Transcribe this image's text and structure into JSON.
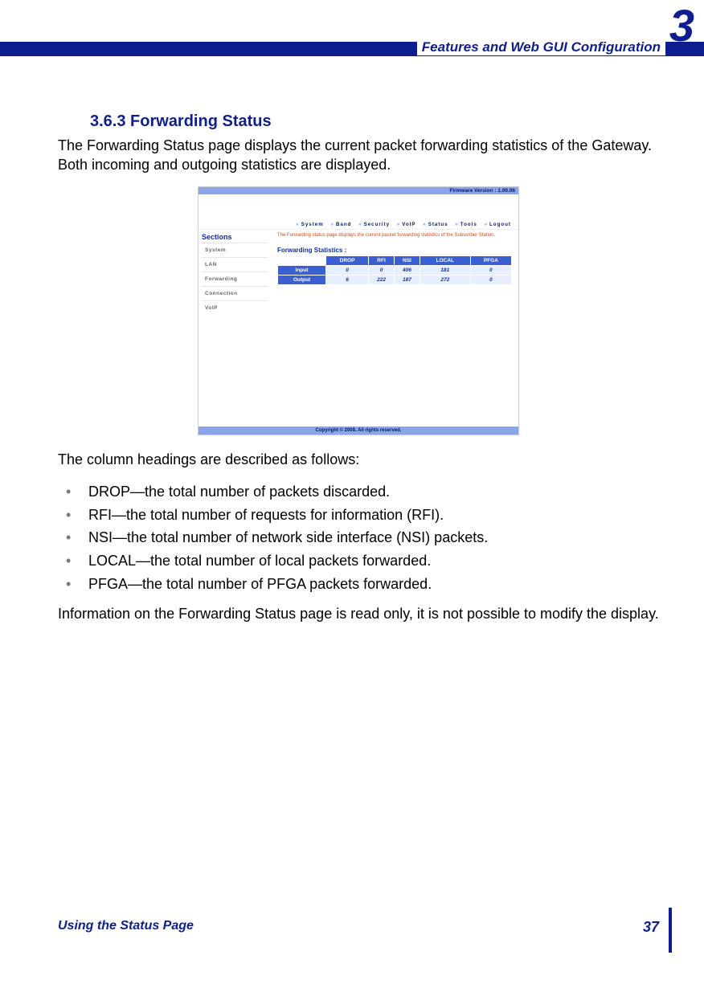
{
  "header": {
    "chapter_title": "Features and Web GUI Configuration",
    "chapter_number": "3"
  },
  "section": {
    "number_title": "3.6.3 Forwarding Status",
    "intro": "The Forwarding Status page displays the current packet forwarding statistics of the Gateway. Both incoming and outgoing statistics are displayed.",
    "post_shot": "The column headings are described as follows:",
    "bullets": [
      "DROP—the total number of packets discarded.",
      "RFI—the total number of requests for information (RFI).",
      "NSI—the total number of network side interface (NSI) packets.",
      "LOCAL—the total number of local packets forwarded.",
      "PFGA—the total number of PFGA packets forwarded."
    ],
    "closing": "Information on the Forwarding Status page is read only, it is not possible to modify the display."
  },
  "screenshot": {
    "firmware": "Firmware Version : 1.00.06",
    "menu": [
      "System",
      "Band",
      "Security",
      "VoIP",
      "Status",
      "Tools",
      "Logout"
    ],
    "sidebar_title": "Sections",
    "sidebar": [
      "System",
      "LAN",
      "Forwarding",
      "Connection",
      "VoIP"
    ],
    "pane_desc": "The Forwarding status page displays the current packet forwarding statistics of the Subscriber Station.",
    "table_title": "Forwarding Statistics :",
    "cols": [
      "DROP",
      "RFI",
      "NSI",
      "LOCAL",
      "PFGA"
    ],
    "rows": [
      {
        "label": "Input",
        "vals": [
          "0",
          "0",
          "406",
          "181",
          "0"
        ]
      },
      {
        "label": "Output",
        "vals": [
          "6",
          "222",
          "187",
          "272",
          "0"
        ]
      }
    ],
    "footer": "Copyright © 2008.  All rights reserved."
  },
  "footer": {
    "left": "Using the Status Page",
    "right": "37"
  },
  "chart_data": {
    "type": "table",
    "title": "Forwarding Statistics",
    "columns": [
      "",
      "DROP",
      "RFI",
      "NSI",
      "LOCAL",
      "PFGA"
    ],
    "rows": [
      [
        "Input",
        0,
        0,
        406,
        181,
        0
      ],
      [
        "Output",
        6,
        222,
        187,
        272,
        0
      ]
    ]
  }
}
